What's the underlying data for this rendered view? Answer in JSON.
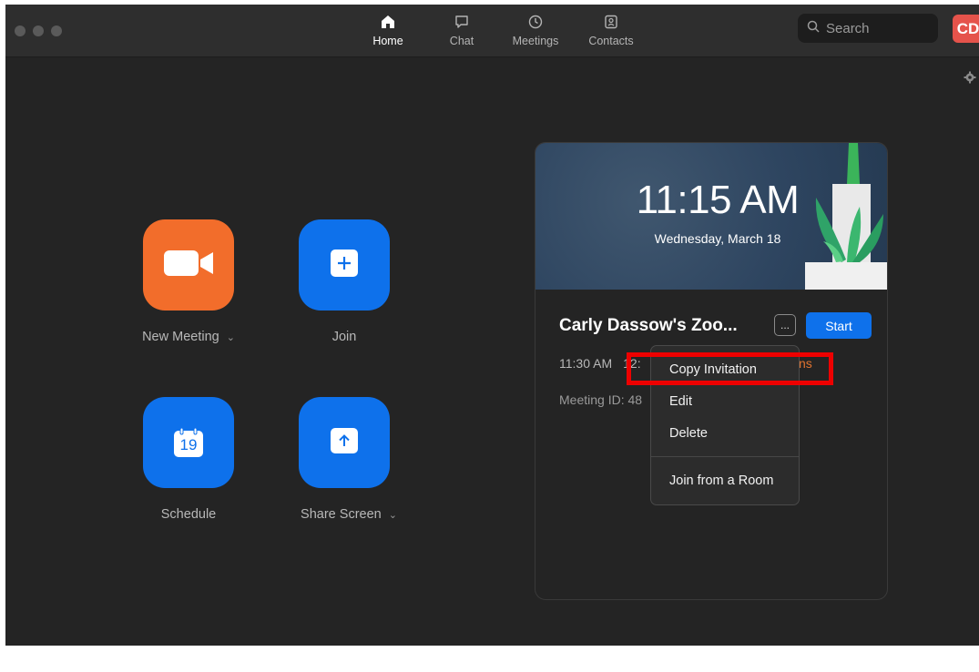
{
  "tabs": [
    {
      "label": "Home",
      "icon": "home-icon",
      "active": true
    },
    {
      "label": "Chat",
      "icon": "chat-icon",
      "active": false
    },
    {
      "label": "Meetings",
      "icon": "clock-icon",
      "active": false
    },
    {
      "label": "Contacts",
      "icon": "contacts-icon",
      "active": false
    }
  ],
  "search": {
    "placeholder": "Search"
  },
  "avatar": {
    "initials": "CD",
    "color": "#e5534b"
  },
  "actions": {
    "new_meeting": {
      "label": "New Meeting",
      "icon": "video-camera-icon",
      "color": "#f26d2b"
    },
    "join": {
      "label": "Join",
      "icon": "plus-icon",
      "color": "#0e71eb"
    },
    "schedule": {
      "label": "Schedule",
      "icon": "calendar-icon",
      "day": "19",
      "color": "#0e71eb"
    },
    "share_screen": {
      "label": "Share Screen",
      "icon": "upload-arrow-icon",
      "color": "#0e71eb"
    }
  },
  "card": {
    "time": "11:15 AM",
    "date": "Wednesday, March 18",
    "meeting_title": "Carly Dassow's Zoo...",
    "more_label": "...",
    "start_label": "Start",
    "start_time": "11:30 AM",
    "end_time_fragment": "12:",
    "orange_fragment": "ns",
    "meeting_id_fragment": "Meeting ID: 48"
  },
  "menu": {
    "items": [
      "Copy Invitation",
      "Edit",
      "Delete"
    ],
    "footer_item": "Join from a Room"
  },
  "highlight": {
    "target": "Copy Invitation",
    "color": "#ee0000"
  }
}
